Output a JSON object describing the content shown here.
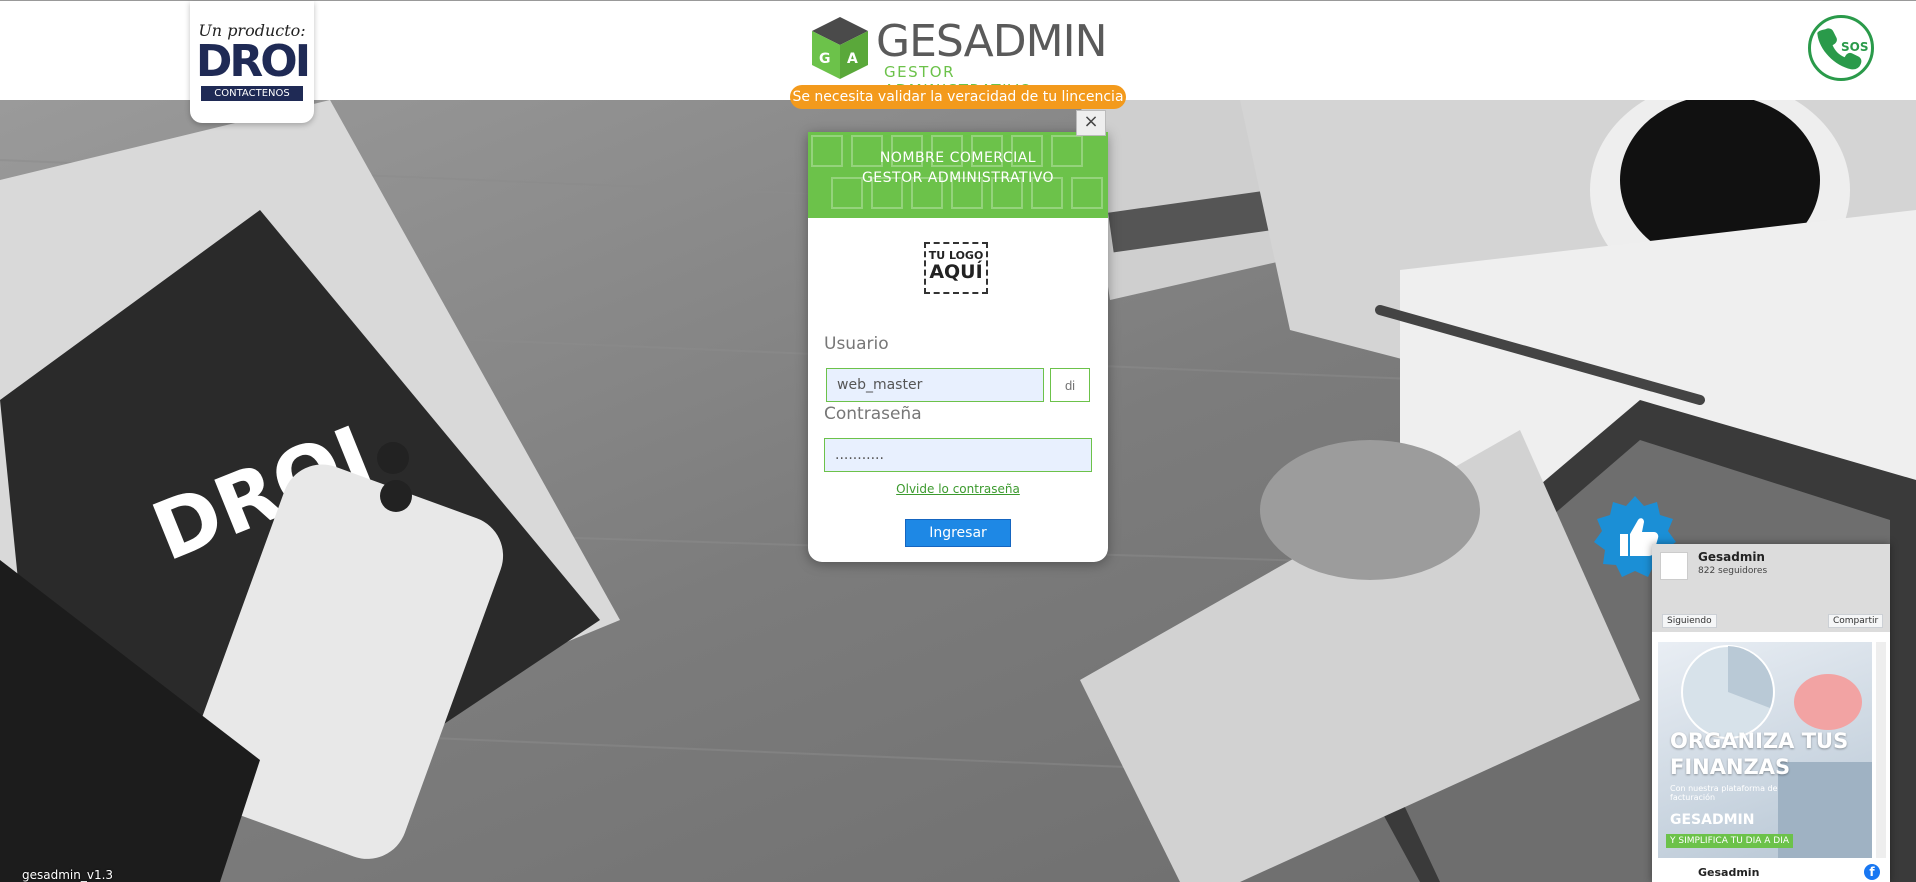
{
  "header": {
    "vendor_tagline": "Un producto:",
    "vendor_name": "DROI",
    "vendor_contact": "CONTACTENOS",
    "brand_name": "GESADMIN",
    "brand_subtitle": "GESTOR ADMINISTRATIVO",
    "license_notice": "Se necesita validar la veracidad de tu lincencia",
    "sos_label": "SOS"
  },
  "login": {
    "close_label": "×",
    "title_line1": "NOMBRE COMERCIAL",
    "title_line2": "GESTOR ADMINISTRATIVO",
    "logo_line1": "TU LOGO",
    "logo_line2": "AQUÍ",
    "user_label": "Usuario",
    "user_value": "web_master",
    "user_suffix_placeholder": "di",
    "password_label": "Contraseña",
    "password_value": "...........",
    "forgot_label": "Olvide lo contraseña",
    "submit_label": "Ingresar"
  },
  "facebook": {
    "page_name": "Gesadmin",
    "followers": "822 seguidores",
    "follow_label": "Siguiendo",
    "share_label": "Compartir",
    "post_title_line1": "ORGANIZA TUS",
    "post_title_line2": "FINANZAS",
    "post_subtitle": "Con nuestra plataforma de facturación",
    "post_brand": "GESADMIN",
    "post_tag": "Y SIMPLIFICA TU DIA A DIA",
    "footer_name": "Gesadmin",
    "fb_icon": "f"
  },
  "footer": {
    "version": "gesadmin_v1.3"
  },
  "colors": {
    "brand_green": "#6cc24a",
    "notice_orange": "#f39a1c",
    "button_blue": "#1e88e5",
    "droi_navy": "#1f2a55"
  }
}
